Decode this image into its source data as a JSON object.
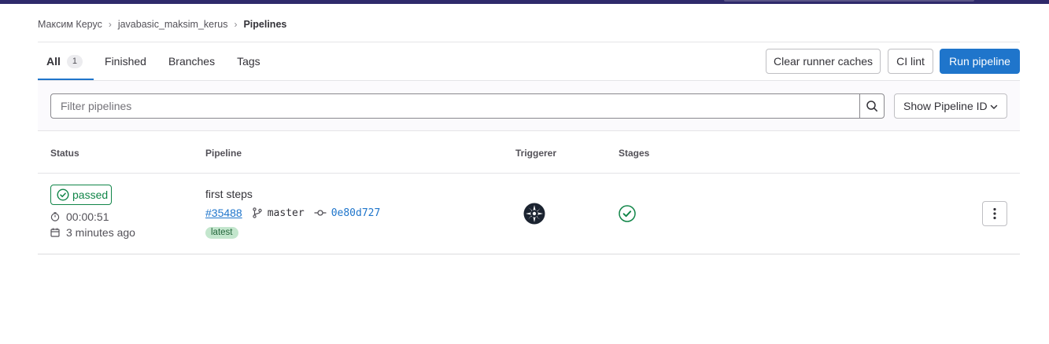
{
  "breadcrumb": [
    {
      "label": "Максим Керус"
    },
    {
      "label": "javabasic_maksim_kerus"
    },
    {
      "label": "Pipelines"
    }
  ],
  "tabs": [
    {
      "label": "All",
      "count": "1",
      "active": true
    },
    {
      "label": "Finished"
    },
    {
      "label": "Branches"
    },
    {
      "label": "Tags"
    }
  ],
  "actions": {
    "clear_caches": "Clear runner caches",
    "ci_lint": "CI lint",
    "run_pipeline": "Run pipeline"
  },
  "filter": {
    "placeholder": "Filter pipelines",
    "show_id_label": "Show Pipeline ID"
  },
  "table": {
    "headers": {
      "status": "Status",
      "pipeline": "Pipeline",
      "triggerer": "Triggerer",
      "stages": "Stages"
    },
    "rows": [
      {
        "status": "passed",
        "duration": "00:00:51",
        "finished": "3 minutes ago",
        "title": "first steps",
        "pipeline_id": "#35488",
        "branch": "master",
        "commit": "0e80d727",
        "badge": "latest",
        "stage_status": "passed"
      }
    ]
  },
  "colors": {
    "accent": "#1f75cb",
    "success": "#108548",
    "header_bar": "#2f2a6b"
  },
  "icons": {
    "search": "search-icon",
    "chevron": "chevron-down-icon",
    "status": "status-success-icon",
    "timer": "timer-icon",
    "calendar": "calendar-icon",
    "branch": "branch-icon",
    "commit": "commit-icon",
    "kebab": "ellipsis-v-icon"
  }
}
